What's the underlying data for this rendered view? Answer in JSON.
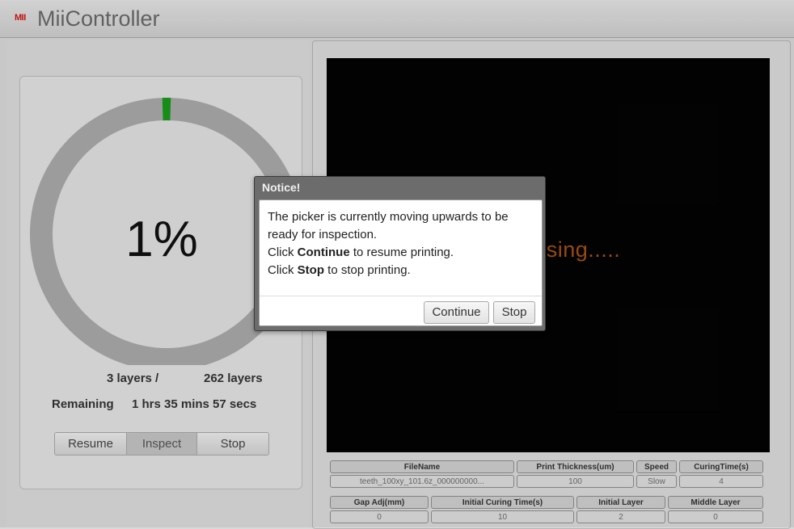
{
  "header": {
    "logo_text": "MII",
    "title": "MiiController"
  },
  "progress": {
    "percent_text": "1%",
    "fraction": 0.01,
    "current_layers": "3 layers /",
    "total_layers": "262 layers",
    "remaining_label": "Remaining",
    "remaining_value": "1 hrs 35 mins 57 secs",
    "colors": {
      "ring": "#aaaaaa",
      "ring_bg": "#e1e1e1",
      "indicator": "#1a9a1a"
    }
  },
  "controls": {
    "resume": "Resume",
    "inspect": "Inspect",
    "stop": "Stop"
  },
  "preview": {
    "status_text": "Processing....."
  },
  "table1": {
    "headers": [
      "FileName",
      "Print Thickness(um)",
      "Speed",
      "CuringTime(s)"
    ],
    "values": [
      "teeth_100xy_101.6z_000000000...",
      "100",
      "Slow",
      "4"
    ]
  },
  "table2": {
    "headers": [
      "Gap Adj(mm)",
      "Initial Curing Time(s)",
      "Initial Layer",
      "Middle Layer"
    ],
    "values": [
      "0",
      "10",
      "2",
      "0"
    ]
  },
  "modal": {
    "title": "Notice!",
    "line1": "The picker is currently moving upwards to be ready for inspection.",
    "line2_pre": "Click ",
    "line2_bold": "Continue",
    "line2_post": " to resume printing.",
    "line3_pre": "Click ",
    "line3_bold": "Stop",
    "line3_post": " to stop printing.",
    "continue_label": "Continue",
    "stop_label": "Stop"
  }
}
